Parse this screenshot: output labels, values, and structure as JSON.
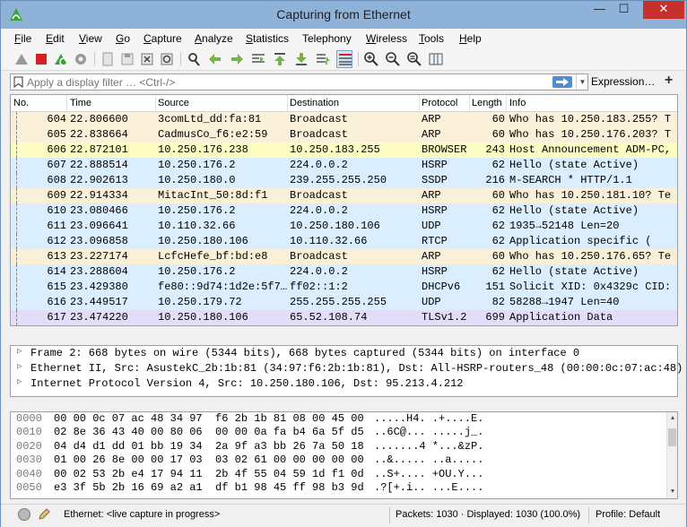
{
  "window": {
    "title": "Capturing from Ethernet",
    "controls": {
      "minimize": "—",
      "maximize": "☐",
      "close": "✕"
    }
  },
  "menu": [
    {
      "key": "F",
      "rest": "ile"
    },
    {
      "key": "E",
      "rest": "dit"
    },
    {
      "key": "V",
      "rest": "iew"
    },
    {
      "key": "G",
      "rest": "o"
    },
    {
      "key": "C",
      "rest": "apture"
    },
    {
      "key": "A",
      "rest": "nalyze"
    },
    {
      "key": "S",
      "rest": "tatistics"
    },
    {
      "key": "",
      "rest": "Telephony"
    },
    {
      "key": "W",
      "rest": "ireless"
    },
    {
      "key": "T",
      "rest": "ools"
    },
    {
      "key": "H",
      "rest": "elp"
    }
  ],
  "filter": {
    "placeholder": "Apply a display filter … <Ctrl-/>",
    "expression_label": "Expression…",
    "add_label": "+"
  },
  "packet_list": {
    "columns": [
      "No.",
      "Time",
      "Source",
      "Destination",
      "Protocol",
      "Length",
      "Info"
    ],
    "rows": [
      {
        "no": "604",
        "time": "22.806600",
        "src": "3comLtd_dd:fa:81",
        "dst": "Broadcast",
        "proto": "ARP",
        "len": "60",
        "info": "Who has 10.250.183.255? T",
        "color": "#faf0d7"
      },
      {
        "no": "605",
        "time": "22.838664",
        "src": "CadmusCo_f6:e2:59",
        "dst": "Broadcast",
        "proto": "ARP",
        "len": "60",
        "info": "Who has 10.250.176.203? T",
        "color": "#faf0d7"
      },
      {
        "no": "606",
        "time": "22.872101",
        "src": "10.250.176.238",
        "dst": "10.250.183.255",
        "proto": "BROWSER",
        "len": "243",
        "info": "Host Announcement ADM-PC,",
        "color": "#fefdc4"
      },
      {
        "no": "607",
        "time": "22.888514",
        "src": "10.250.176.2",
        "dst": "224.0.0.2",
        "proto": "HSRP",
        "len": "62",
        "info": "Hello (state Active)",
        "color": "#daeeff"
      },
      {
        "no": "608",
        "time": "22.902613",
        "src": "10.250.180.0",
        "dst": "239.255.255.250",
        "proto": "SSDP",
        "len": "216",
        "info": "M-SEARCH * HTTP/1.1",
        "color": "#daeeff"
      },
      {
        "no": "609",
        "time": "22.914334",
        "src": "MitacInt_50:8d:f1",
        "dst": "Broadcast",
        "proto": "ARP",
        "len": "60",
        "info": "Who has 10.250.181.10? Te",
        "color": "#faf0d7"
      },
      {
        "no": "610",
        "time": "23.080466",
        "src": "10.250.176.2",
        "dst": "224.0.0.2",
        "proto": "HSRP",
        "len": "62",
        "info": "Hello (state Active)",
        "color": "#daeeff"
      },
      {
        "no": "611",
        "time": "23.096641",
        "src": "10.110.32.66",
        "dst": "10.250.180.106",
        "proto": "UDP",
        "len": "62",
        "info": "1935→52148 Len=20",
        "color": "#daeeff"
      },
      {
        "no": "612",
        "time": "23.096858",
        "src": "10.250.180.106",
        "dst": "10.110.32.66",
        "proto": "RTCP",
        "len": "62",
        "info": "Application specific   (",
        "color": "#daeeff"
      },
      {
        "no": "613",
        "time": "23.227174",
        "src": "LcfcHefe_bf:bd:e8",
        "dst": "Broadcast",
        "proto": "ARP",
        "len": "60",
        "info": "Who has 10.250.176.65? Te",
        "color": "#faf0d7"
      },
      {
        "no": "614",
        "time": "23.288604",
        "src": "10.250.176.2",
        "dst": "224.0.0.2",
        "proto": "HSRP",
        "len": "62",
        "info": "Hello (state Active)",
        "color": "#daeeff"
      },
      {
        "no": "615",
        "time": "23.429380",
        "src": "fe80::9d74:1d2e:5f7…",
        "dst": "ff02::1:2",
        "proto": "DHCPv6",
        "len": "151",
        "info": "Solicit XID: 0x4329c CID:",
        "color": "#daeeff"
      },
      {
        "no": "616",
        "time": "23.449517",
        "src": "10.250.179.72",
        "dst": "255.255.255.255",
        "proto": "UDP",
        "len": "82",
        "info": "58288→1947 Len=40",
        "color": "#daeeff"
      },
      {
        "no": "617",
        "time": "23.474220",
        "src": "10.250.180.106",
        "dst": "65.52.108.74",
        "proto": "TLSv1.2",
        "len": "699",
        "info": "Application Data",
        "color": "#e4ddfa"
      }
    ]
  },
  "details": [
    "Frame 2: 668 bytes on wire (5344 bits), 668 bytes captured (5344 bits) on interface 0",
    "Ethernet II, Src: AsustekC_2b:1b:81 (34:97:f6:2b:1b:81), Dst: All-HSRP-routers_48 (00:00:0c:07:ac:48)",
    "Internet Protocol Version 4, Src: 10.250.180.106, Dst: 95.213.4.212"
  ],
  "hexdump": [
    {
      "offset": "0000",
      "hex": "00 00 0c 07 ac 48 34 97  f6 2b 1b 81 08 00 45 00",
      "ascii": ".....H4. .+....E."
    },
    {
      "offset": "0010",
      "hex": "02 8e 36 43 40 00 80 06  00 00 0a fa b4 6a 5f d5",
      "ascii": "..6C@... .....j_."
    },
    {
      "offset": "0020",
      "hex": "04 d4 d1 dd 01 bb 19 34  2a 9f a3 bb 26 7a 50 18",
      "ascii": ".......4 *...&zP."
    },
    {
      "offset": "0030",
      "hex": "01 00 26 8e 00 00 17 03  03 02 61 00 00 00 00 00",
      "ascii": "..&..... ..a....."
    },
    {
      "offset": "0040",
      "hex": "00 02 53 2b e4 17 94 11  2b 4f 55 04 59 1d f1 0d",
      "ascii": "..S+.... +OU.Y..."
    },
    {
      "offset": "0050",
      "hex": "e3 3f 5b 2b 16 69 a2 a1  df b1 98 45 ff 98 b3 9d",
      "ascii": ".?[+.i.. ...E...."
    }
  ],
  "status": {
    "interface_text": "Ethernet: <live capture in progress>",
    "packets_text": "Packets: 1030 · Displayed: 1030 (100.0%)",
    "profile_text": "Profile: Default"
  },
  "colors": {
    "titlebar": "#8fb2d9",
    "close_button": "#c7312b",
    "arp_row": "#faf0d7",
    "udp_row": "#daeeff",
    "tls_row": "#e4ddfa",
    "browser_row": "#fefdc4"
  },
  "icons": [
    "shark-fin-icon",
    "stop-icon",
    "restart-icon",
    "options-gear-icon",
    "open-folder-icon",
    "save-icon",
    "close-file-icon",
    "reload-icon",
    "find-icon",
    "back-arrow-icon",
    "forward-arrow-icon",
    "goto-icon",
    "first-packet-icon",
    "last-packet-icon",
    "autoscroll-icon",
    "colorize-icon",
    "zoom-in-icon",
    "zoom-out-icon",
    "zoom-normal-icon",
    "resize-columns-icon"
  ]
}
